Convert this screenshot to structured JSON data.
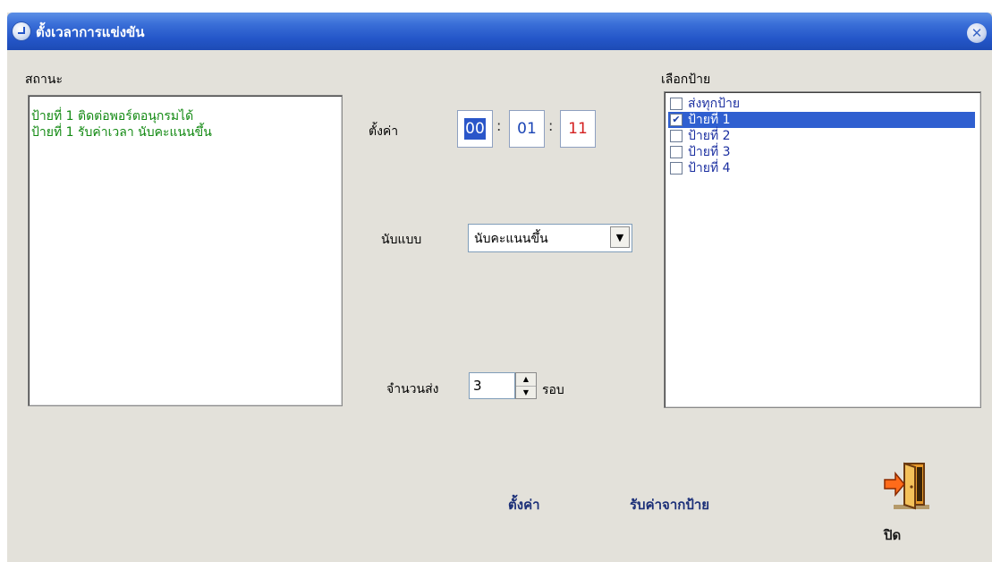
{
  "window": {
    "title": "ตั้งเวลาการแข่งขัน"
  },
  "status": {
    "label": "สถานะ",
    "lines": [
      "ป้ายที่ 1 ติดต่อพอร์ตอนุกรมได้",
      "ป้ายที่ 1 รับค่าเวลา นับคะแนนขึ้น"
    ]
  },
  "time": {
    "label": "ตั้งค่า",
    "hh": "00",
    "mm": "01",
    "ss": "11",
    "sep": ":"
  },
  "count_mode": {
    "label": "นับแบบ",
    "selected": "นับคะแนนขึ้น"
  },
  "send_count": {
    "label": "จำนวนส่ง",
    "value": "3",
    "unit": "รอบ"
  },
  "sign_select": {
    "label": "เลือกป้าย",
    "items": [
      {
        "label": "ส่งทุกป้าย",
        "checked": false
      },
      {
        "label": "ป้ายที่ 1",
        "checked": true
      },
      {
        "label": "ป้ายที่ 2",
        "checked": false
      },
      {
        "label": "ป้ายที่ 3",
        "checked": false
      },
      {
        "label": "ป้ายที่ 4",
        "checked": false
      }
    ]
  },
  "actions": {
    "set": "ตั้งค่า",
    "fetch": "รับค่าจากป้าย",
    "close": "ปิด"
  },
  "colors": {
    "title_bar": "#2456c8",
    "status_text": "#138a13",
    "seconds": "#d42020",
    "selection": "#2f5fd0"
  }
}
